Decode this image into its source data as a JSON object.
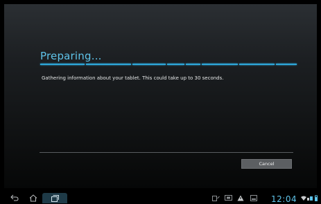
{
  "dialog": {
    "title": "Preparing...",
    "message": "Gathering information about your tablet. This could take up to 30 seconds.",
    "cancel_label": "Cancel"
  },
  "status_bar": {
    "time": "12:04"
  },
  "navigation": {
    "icons": [
      "back-icon",
      "home-icon",
      "recent-apps-icon"
    ]
  },
  "notifications": {
    "icons": [
      "storage-icon",
      "screenshot-icon",
      "warning-icon",
      "download-icon",
      "wifi-icon",
      "signal-icon",
      "battery-icon"
    ]
  },
  "colors": {
    "accent": "#5fc4ea",
    "progress": "#2ea7d9",
    "button_bg": "#5c5f62"
  }
}
